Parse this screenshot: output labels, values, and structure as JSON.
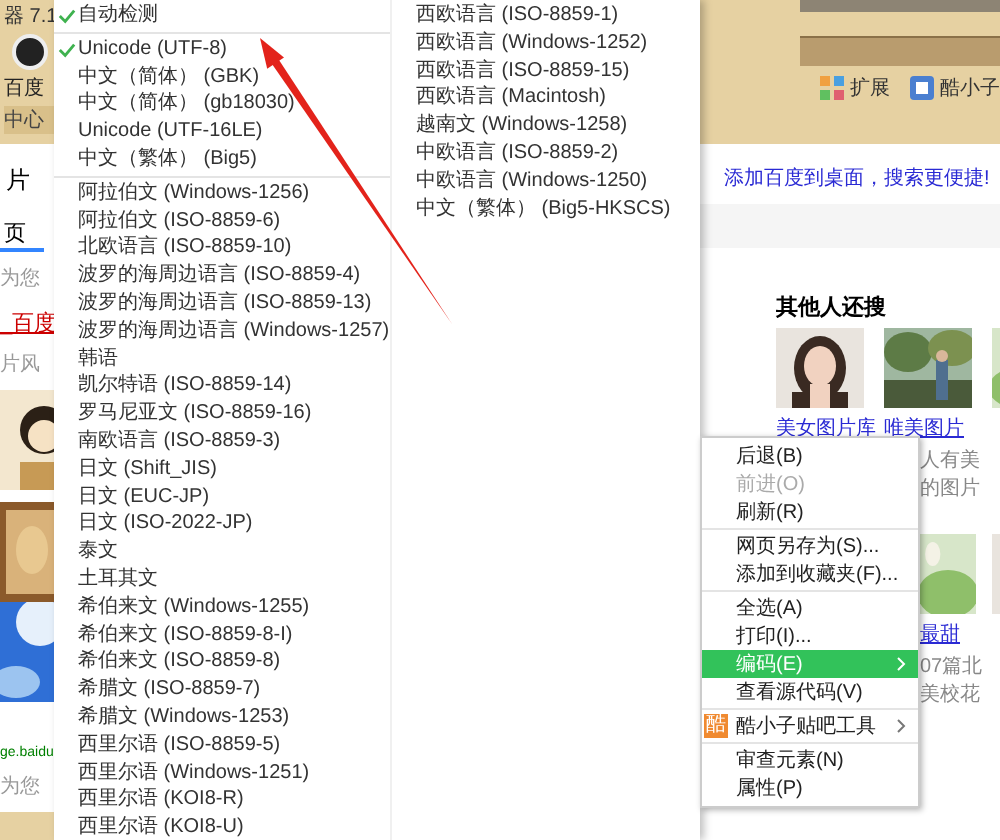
{
  "browser": {
    "title": "器 7.1",
    "bookmark": "百度",
    "tab": "中心",
    "toolbar": [
      {
        "label": "扩展",
        "kind": "grid"
      },
      {
        "label": "酷小子",
        "kind": "app"
      }
    ]
  },
  "page_left": {
    "search_value": "片",
    "nav_tab": "页",
    "result_note": "为您",
    "result_link": "_百度",
    "style_label": "片风",
    "site_link": "ge.baidu",
    "recommend": "为您"
  },
  "promo_link": "添加百度到桌面，搜索更便捷!",
  "related": {
    "title": "其他人还搜",
    "rows": [
      [
        {
          "kind": "picture",
          "label": "美女图片库"
        },
        {
          "kind": "picture",
          "label": "唯美图片",
          "desc": "人有美的图片"
        },
        {
          "kind": "picture"
        }
      ],
      [
        {
          "kind": "empty"
        },
        {
          "kind": "picture",
          "label": "最甜",
          "desc": "07篇北美校花"
        },
        {
          "kind": "picture"
        }
      ]
    ]
  },
  "encoding_menu": {
    "columns": [
      [
        [
          {
            "label": "自动检测",
            "checked": true
          }
        ],
        [
          {
            "label": "Unicode (UTF-8)",
            "checked": true
          },
          {
            "label": "中文（简体） (GBK)",
            "checked": false
          },
          {
            "label": "中文（简体） (gb18030)",
            "checked": false
          },
          {
            "label": "Unicode (UTF-16LE)",
            "checked": false
          },
          {
            "label": "中文（繁体） (Big5)",
            "checked": false
          }
        ],
        [
          {
            "label": "阿拉伯文 (Windows-1256)",
            "checked": false
          },
          {
            "label": "阿拉伯文 (ISO-8859-6)",
            "checked": false
          },
          {
            "label": "北欧语言 (ISO-8859-10)",
            "checked": false
          },
          {
            "label": "波罗的海周边语言 (ISO-8859-4)",
            "checked": false
          },
          {
            "label": "波罗的海周边语言 (ISO-8859-13)",
            "checked": false
          },
          {
            "label": "波罗的海周边语言 (Windows-1257)",
            "checked": false
          },
          {
            "label": "韩语",
            "checked": false
          },
          {
            "label": "凯尔特语 (ISO-8859-14)",
            "checked": false
          },
          {
            "label": "罗马尼亚文 (ISO-8859-16)",
            "checked": false
          },
          {
            "label": "南欧语言 (ISO-8859-3)",
            "checked": false
          },
          {
            "label": "日文 (Shift_JIS)",
            "checked": false
          },
          {
            "label": "日文 (EUC-JP)",
            "checked": false
          },
          {
            "label": "日文 (ISO-2022-JP)",
            "checked": false
          },
          {
            "label": "泰文",
            "checked": false
          },
          {
            "label": "土耳其文",
            "checked": false
          },
          {
            "label": "希伯来文 (Windows-1255)",
            "checked": false
          },
          {
            "label": "希伯来文 (ISO-8859-8-I)",
            "checked": false
          },
          {
            "label": "希伯来文 (ISO-8859-8)",
            "checked": false
          },
          {
            "label": "希腊文 (ISO-8859-7)",
            "checked": false
          },
          {
            "label": "希腊文 (Windows-1253)",
            "checked": false
          },
          {
            "label": "西里尔语 (ISO-8859-5)",
            "checked": false
          },
          {
            "label": "西里尔语 (Windows-1251)",
            "checked": false
          },
          {
            "label": "西里尔语 (KOI8-R)",
            "checked": false
          },
          {
            "label": "西里尔语 (KOI8-U)",
            "checked": false
          }
        ]
      ],
      [
        [
          {
            "label": "西欧语言 (ISO-8859-1)",
            "checked": false
          },
          {
            "label": "西欧语言 (Windows-1252)",
            "checked": false
          },
          {
            "label": "西欧语言 (ISO-8859-15)",
            "checked": false
          },
          {
            "label": "西欧语言 (Macintosh)",
            "checked": false
          },
          {
            "label": "越南文 (Windows-1258)",
            "checked": false
          },
          {
            "label": "中欧语言 (ISO-8859-2)",
            "checked": false
          },
          {
            "label": "中欧语言 (Windows-1250)",
            "checked": false
          },
          {
            "label": "中文（繁体） (Big5-HKSCS)",
            "checked": false
          }
        ]
      ]
    ]
  },
  "context_menu": [
    [
      {
        "label": "后退(B)",
        "disabled": false,
        "selected": false,
        "submenu": false
      },
      {
        "label": "前进(O)",
        "disabled": true,
        "selected": false,
        "submenu": false
      },
      {
        "label": "刷新(R)",
        "disabled": false,
        "selected": false,
        "submenu": false
      }
    ],
    [
      {
        "label": "网页另存为(S)...",
        "disabled": false,
        "selected": false,
        "submenu": false
      },
      {
        "label": "添加到收藏夹(F)...",
        "disabled": false,
        "selected": false,
        "submenu": false
      }
    ],
    [
      {
        "label": "全选(A)",
        "disabled": false,
        "selected": false,
        "submenu": false
      },
      {
        "label": "打印(I)...",
        "disabled": false,
        "selected": false,
        "submenu": false
      },
      {
        "label": "编码(E)",
        "disabled": false,
        "selected": true,
        "submenu": true
      },
      {
        "label": "查看源代码(V)",
        "disabled": false,
        "selected": false,
        "submenu": false
      }
    ],
    [
      {
        "label": "酷小子贴吧工具",
        "disabled": false,
        "selected": false,
        "submenu": true,
        "badge": "酷"
      }
    ],
    [
      {
        "label": "审查元素(N)",
        "disabled": false,
        "selected": false,
        "submenu": false
      },
      {
        "label": "属性(P)",
        "disabled": false,
        "selected": false,
        "submenu": false
      }
    ]
  ]
}
